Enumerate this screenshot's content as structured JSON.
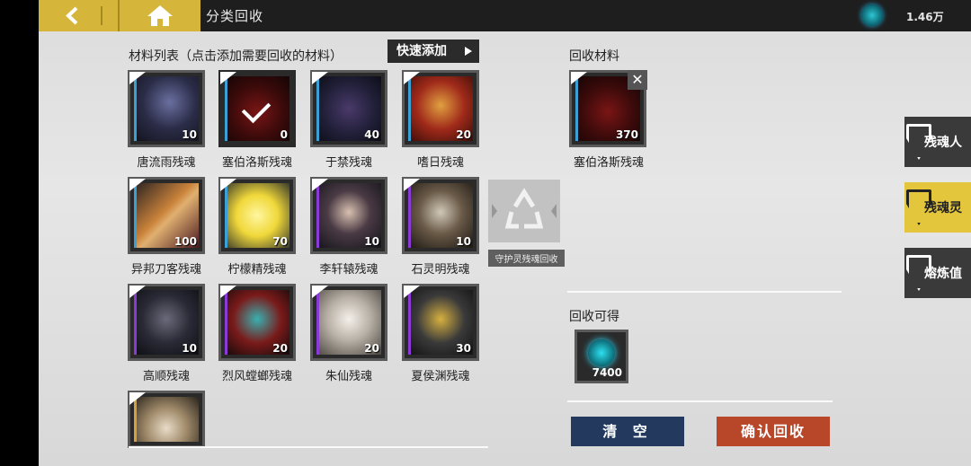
{
  "header": {
    "title": "分类回收",
    "currency_amount": "1.46万"
  },
  "materials": {
    "section_label": "材料列表（点击添加需要回收的材料）",
    "quick_add_label": "快速添加",
    "items": [
      {
        "name": "唐流雨残魂",
        "count": "10"
      },
      {
        "name": "塞伯洛斯残魂",
        "count": "0"
      },
      {
        "name": "于禁残魂",
        "count": "40"
      },
      {
        "name": "嗜日残魂",
        "count": "20"
      },
      {
        "name": "异邦刀客残魂",
        "count": "100"
      },
      {
        "name": "柠檬精残魂",
        "count": "70"
      },
      {
        "name": "李轩辕残魂",
        "count": "10"
      },
      {
        "name": "石灵明残魂",
        "count": "10"
      },
      {
        "name": "高顺残魂",
        "count": "10"
      },
      {
        "name": "烈风螳螂残魂",
        "count": "20"
      },
      {
        "name": "朱仙残魂",
        "count": "20"
      },
      {
        "name": "夏侯渊残魂",
        "count": "30"
      },
      {
        "name": "",
        "count": ""
      }
    ]
  },
  "recycle_center": {
    "label": "守护灵残魂回收"
  },
  "recycle_materials": {
    "section_label": "回收材料",
    "item": {
      "name": "塞伯洛斯残魂",
      "count": "370"
    }
  },
  "recycle_gain": {
    "section_label": "回收可得",
    "count": "7400"
  },
  "actions": {
    "clear_label": "清 空",
    "confirm_label": "确认回收"
  },
  "side_tabs": [
    {
      "label": "残魂人",
      "active": false
    },
    {
      "label": "残魂灵",
      "active": true
    },
    {
      "label": "熔炼值",
      "active": false
    }
  ],
  "colors": {
    "header_bg": "#1e1e1e",
    "gold": "#d6b53b",
    "clear_button": "#233a5e",
    "confirm_button": "#b8472a"
  }
}
